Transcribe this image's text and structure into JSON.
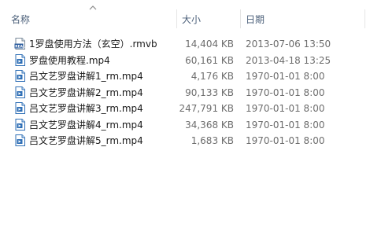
{
  "columns": {
    "name": "名称",
    "size": "大小",
    "date": "日期"
  },
  "files": [
    {
      "name": "1罗盘使用方法（玄空）.rmvb",
      "size": "14,404 KB",
      "date": "2013-07-06 13:50",
      "icon": "rmvb-video-file-icon"
    },
    {
      "name": "罗盘使用教程.mp4",
      "size": "60,161 KB",
      "date": "2013-04-18 13:25",
      "icon": "mp4-video-file-icon"
    },
    {
      "name": "吕文艺罗盘讲解1_rm.mp4",
      "size": "4,176 KB",
      "date": "1970-01-01 8:00",
      "icon": "mp4-video-file-icon"
    },
    {
      "name": "吕文艺罗盘讲解2_rm.mp4",
      "size": "90,133 KB",
      "date": "1970-01-01 8:00",
      "icon": "mp4-video-file-icon"
    },
    {
      "name": "吕文艺罗盘讲解3_rm.mp4",
      "size": "247,791 KB",
      "date": "1970-01-01 8:00",
      "icon": "mp4-video-file-icon"
    },
    {
      "name": "吕文艺罗盘讲解4_rm.mp4",
      "size": "34,368 KB",
      "date": "1970-01-01 8:00",
      "icon": "mp4-video-file-icon"
    },
    {
      "name": "吕文艺罗盘讲解5_rm.mp4",
      "size": "1,683 KB",
      "date": "1970-01-01 8:00",
      "icon": "mp4-video-file-icon"
    }
  ]
}
